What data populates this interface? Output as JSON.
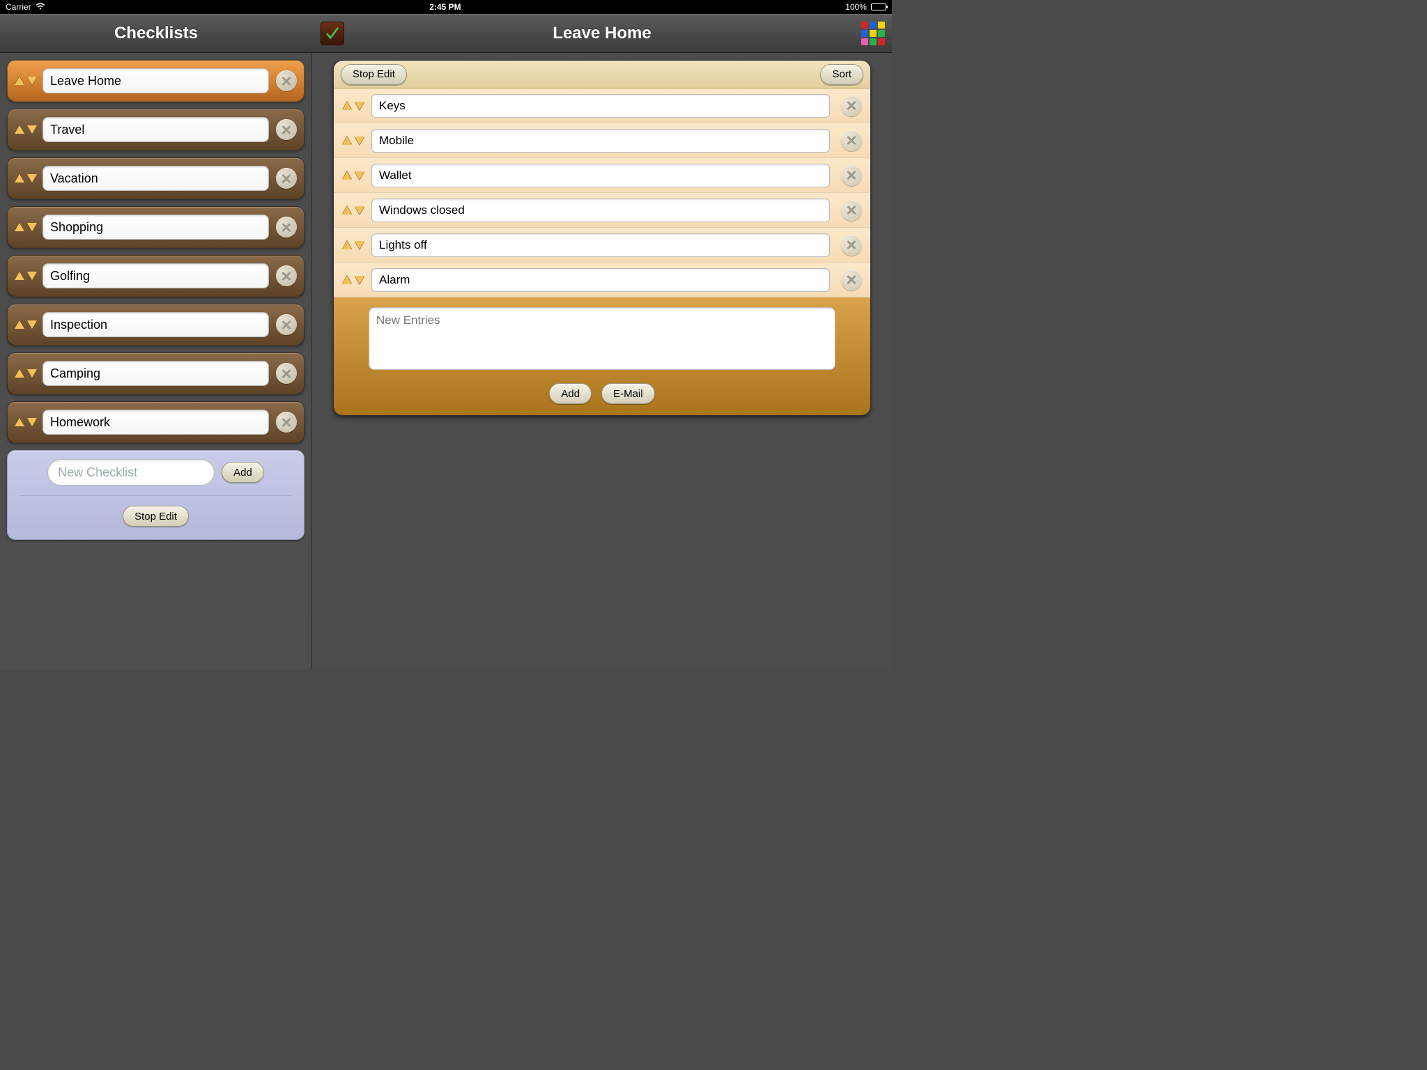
{
  "status": {
    "carrier": "Carrier",
    "time": "2:45 PM",
    "battery": "100%"
  },
  "left": {
    "title": "Checklists",
    "checklists": [
      {
        "name": "Leave Home",
        "selected": true
      },
      {
        "name": "Travel",
        "selected": false
      },
      {
        "name": "Vacation",
        "selected": false
      },
      {
        "name": "Shopping",
        "selected": false
      },
      {
        "name": "Golfing",
        "selected": false
      },
      {
        "name": "Inspection",
        "selected": false
      },
      {
        "name": "Camping",
        "selected": false
      },
      {
        "name": "Homework",
        "selected": false
      }
    ],
    "newPlaceholder": "New Checklist",
    "addLabel": "Add",
    "stopEditLabel": "Stop Edit"
  },
  "right": {
    "title": "Leave Home",
    "stopEditLabel": "Stop Edit",
    "sortLabel": "Sort",
    "items": [
      {
        "name": "Keys"
      },
      {
        "name": "Mobile"
      },
      {
        "name": "Wallet"
      },
      {
        "name": "Windows closed"
      },
      {
        "name": "Lights off"
      },
      {
        "name": "Alarm"
      }
    ],
    "newEntriesPlaceholder": "New Entries",
    "addLabel": "Add",
    "emailLabel": "E-Mail",
    "gridColors": [
      "#d62424",
      "#1e62d6",
      "#f2d400",
      "#1e62d6",
      "#f2d400",
      "#2bb34a",
      "#e85fb5",
      "#2bb34a",
      "#d62424"
    ]
  }
}
